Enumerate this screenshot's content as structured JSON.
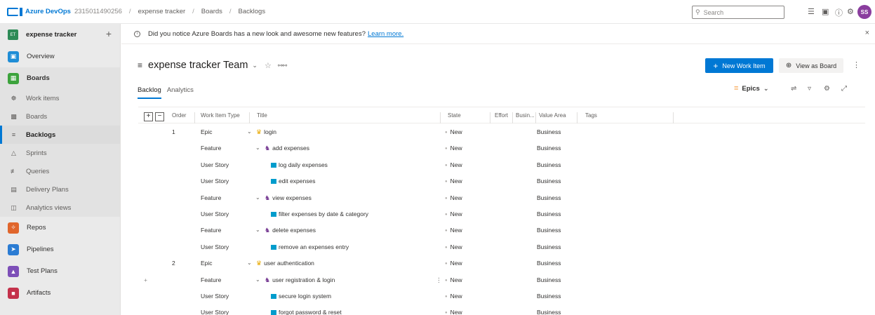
{
  "topbar": {
    "brand": "Azure DevOps",
    "org": "2315011490256",
    "breadcrumbs": [
      "expense tracker",
      "Boards",
      "Backlogs"
    ],
    "separator": "/",
    "search_placeholder": "Search",
    "avatar_initials": "SS"
  },
  "sidebar": {
    "project_badge": "ET",
    "project_name": "expense tracker",
    "add": "+",
    "items": [
      {
        "label": "Overview"
      },
      {
        "label": "Boards"
      },
      {
        "label": "Work items"
      },
      {
        "label": "Boards"
      },
      {
        "label": "Backlogs"
      },
      {
        "label": "Sprints"
      },
      {
        "label": "Queries"
      },
      {
        "label": "Delivery Plans"
      },
      {
        "label": "Analytics views"
      },
      {
        "label": "Repos"
      },
      {
        "label": "Pipelines"
      },
      {
        "label": "Test Plans"
      },
      {
        "label": "Artifacts"
      }
    ]
  },
  "banner": {
    "text": "Did you notice Azure Boards has a new look and awesome new features?",
    "link": "Learn more.",
    "close": "×"
  },
  "header": {
    "team_title": "expense tracker Team",
    "new_work_item": "New Work Item",
    "view_as_board": "View as Board"
  },
  "tabs": [
    "Backlog",
    "Analytics"
  ],
  "toolbar": {
    "level": "Epics"
  },
  "grid": {
    "expand": "+",
    "collapse": "−",
    "columns": [
      "Order",
      "Work Item Type",
      "Title",
      "State",
      "Effort",
      "Busin...",
      "Value Area",
      "Tags"
    ],
    "rows": [
      {
        "order": "1",
        "type": "Epic",
        "title": "login",
        "state": "New",
        "value_area": "Business"
      },
      {
        "order": "",
        "type": "Feature",
        "title": "add expenses",
        "state": "New",
        "value_area": "Business"
      },
      {
        "order": "",
        "type": "User Story",
        "title": "log daily expenses",
        "state": "New",
        "value_area": "Business"
      },
      {
        "order": "",
        "type": "User Story",
        "title": "edit expenses",
        "state": "New",
        "value_area": "Business"
      },
      {
        "order": "",
        "type": "Feature",
        "title": "view expenses",
        "state": "New",
        "value_area": "Business"
      },
      {
        "order": "",
        "type": "User Story",
        "title": "filter expenses by date & category",
        "state": "New",
        "value_area": "Business"
      },
      {
        "order": "",
        "type": "Feature",
        "title": "delete expenses",
        "state": "New",
        "value_area": "Business"
      },
      {
        "order": "",
        "type": "User Story",
        "title": "remove an expenses entry",
        "state": "New",
        "value_area": "Business"
      },
      {
        "order": "2",
        "type": "Epic",
        "title": "user authentication",
        "state": "New",
        "value_area": "Business"
      },
      {
        "order": "",
        "type": "Feature",
        "title": "user registration & login",
        "state": "New",
        "value_area": "Business"
      },
      {
        "order": "",
        "type": "User Story",
        "title": "secure login system",
        "state": "New",
        "value_area": "Business"
      },
      {
        "order": "",
        "type": "User Story",
        "title": "forgot password & reset",
        "state": "New",
        "value_area": "Business"
      }
    ]
  },
  "colors": {
    "accent": "#0078d4",
    "epic": "#e8a900",
    "feature": "#773b93",
    "story": "#009ccc",
    "avatar": "#8a3d9e"
  }
}
